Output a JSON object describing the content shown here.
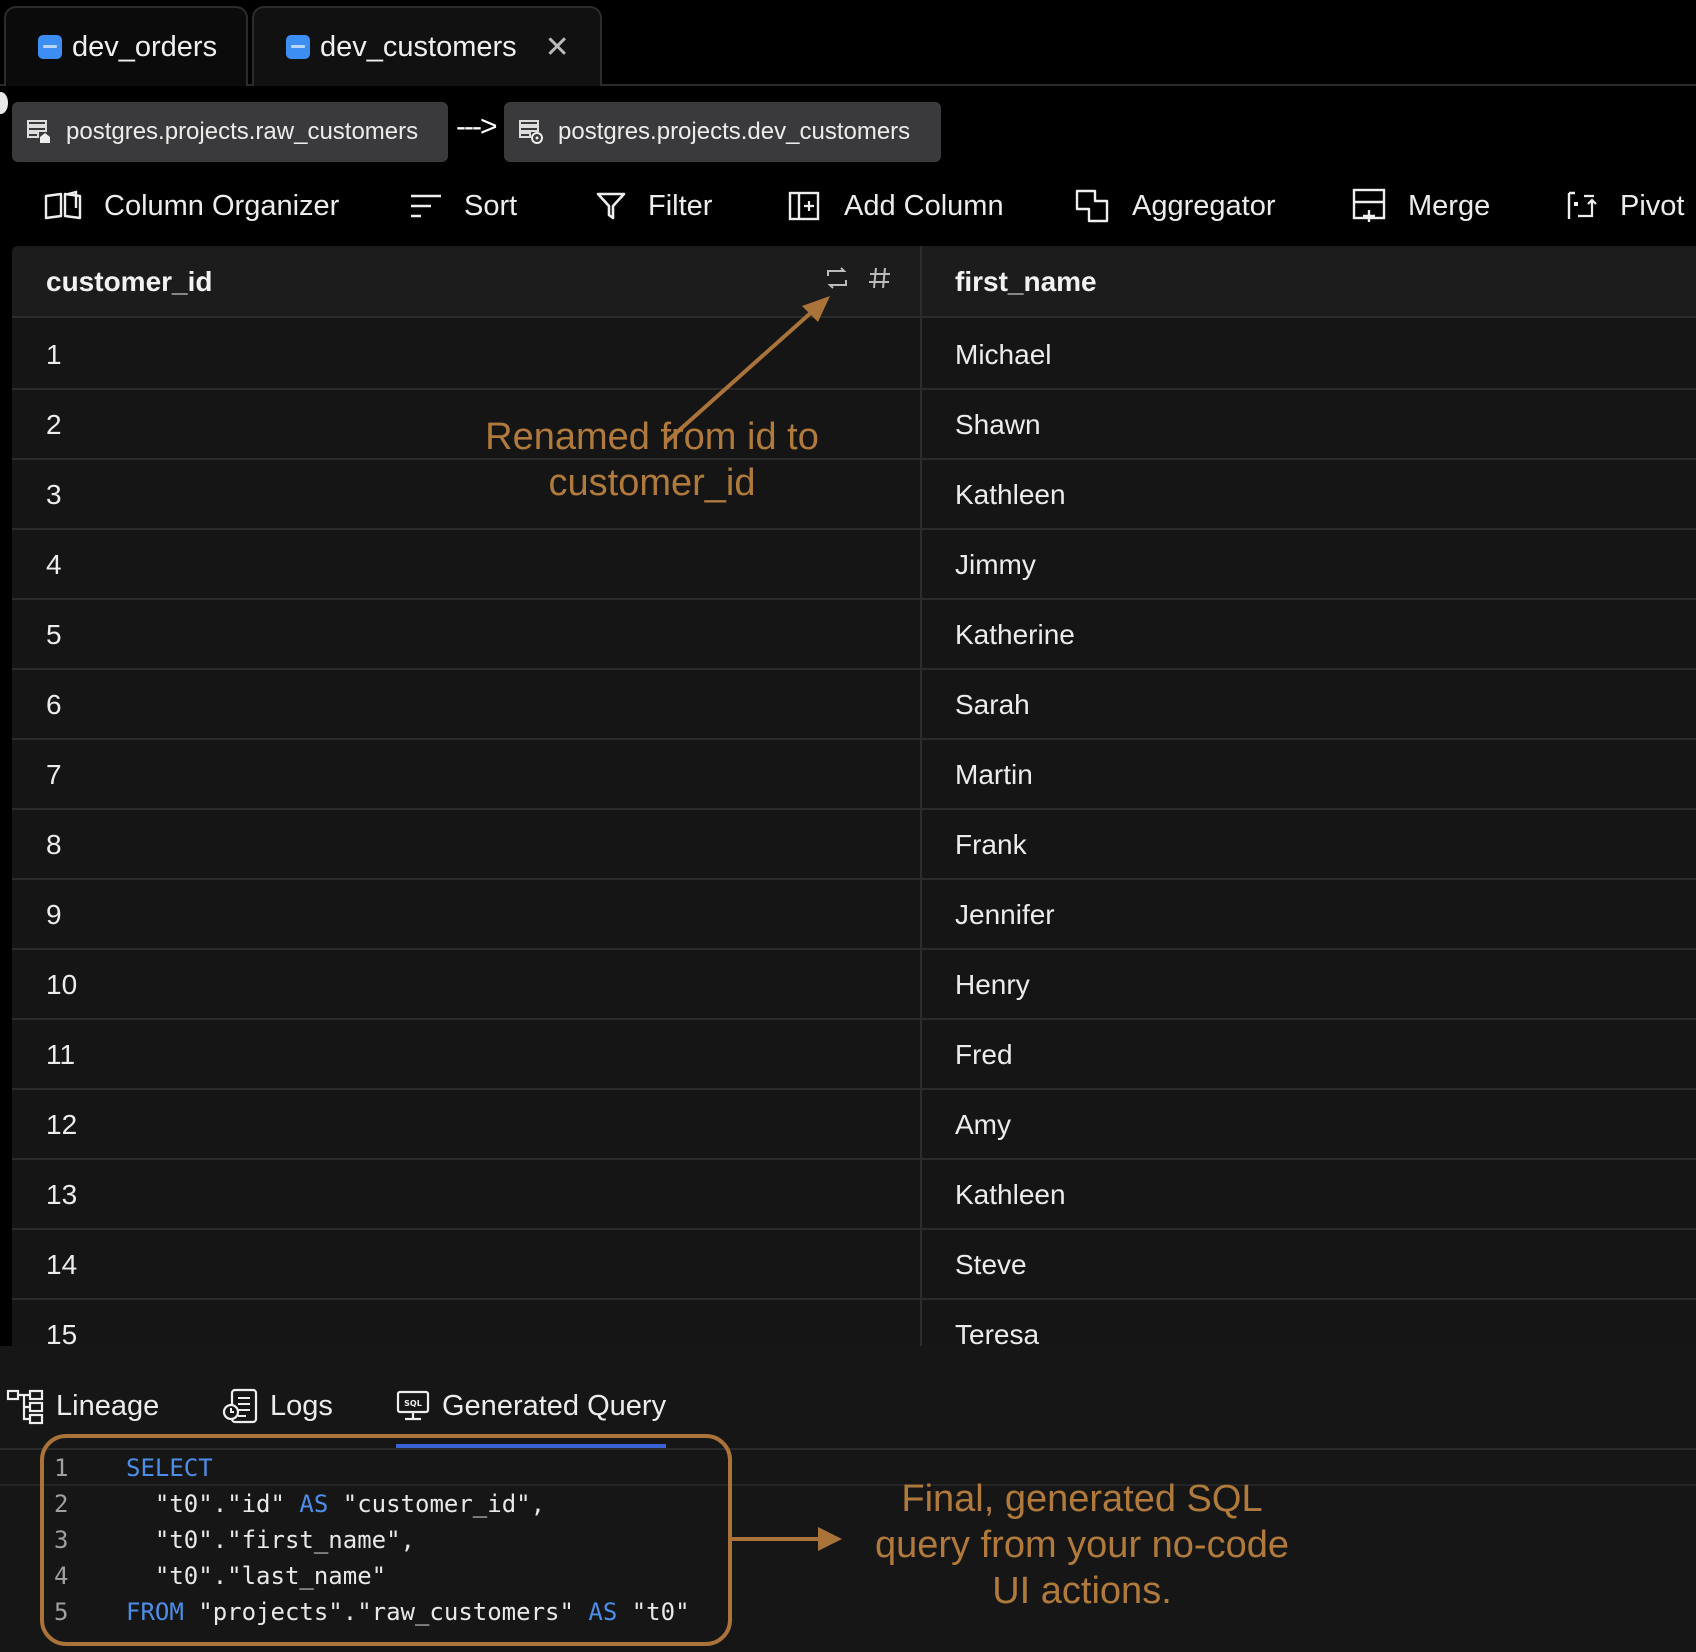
{
  "tabs": [
    {
      "label": "dev_orders",
      "active": false
    },
    {
      "label": "dev_customers",
      "active": true,
      "close": "✕"
    }
  ],
  "lineage": {
    "source": "postgres.projects.raw_customers",
    "arrow": "--->",
    "target": "postgres.projects.dev_customers"
  },
  "toolbar": {
    "column_organizer": "Column Organizer",
    "sort": "Sort",
    "filter": "Filter",
    "add_column": "Add Column",
    "aggregator": "Aggregator",
    "merge": "Merge",
    "pivot": "Pivot"
  },
  "table": {
    "columns": [
      "customer_id",
      "first_name"
    ],
    "rows": [
      [
        "1",
        "Michael"
      ],
      [
        "2",
        "Shawn"
      ],
      [
        "3",
        "Kathleen"
      ],
      [
        "4",
        "Jimmy"
      ],
      [
        "5",
        "Katherine"
      ],
      [
        "6",
        "Sarah"
      ],
      [
        "7",
        "Martin"
      ],
      [
        "8",
        "Frank"
      ],
      [
        "9",
        "Jennifer"
      ],
      [
        "10",
        "Henry"
      ],
      [
        "11",
        "Fred"
      ],
      [
        "12",
        "Amy"
      ],
      [
        "13",
        "Kathleen"
      ],
      [
        "14",
        "Steve"
      ],
      [
        "15",
        "Teresa"
      ]
    ]
  },
  "annotations": {
    "rename_line1": "Renamed from id to",
    "rename_line2": "customer_id",
    "query_line1": "Final, generated SQL",
    "query_line2": "query from your no-code",
    "query_line3": "UI actions."
  },
  "bottom_tabs": {
    "lineage": "Lineage",
    "logs": "Logs",
    "generated_query": "Generated Query"
  },
  "query": {
    "lines": [
      "1",
      "2",
      "3",
      "4",
      "5"
    ],
    "select": "SELECT",
    "l2_a": "  \"t0\".\"id\" ",
    "as": "AS",
    "l2_b": " \"customer_id\",",
    "l3": "  \"t0\".\"first_name\",",
    "l4": "  \"t0\".\"last_name\"",
    "from": "FROM",
    "l5_a": " \"projects\".\"raw_customers\" ",
    "l5_b": " \"t0\""
  },
  "colors": {
    "accent": "#3b63d6",
    "annotation": "#b07a3c",
    "keyword": "#4d8ee8"
  }
}
